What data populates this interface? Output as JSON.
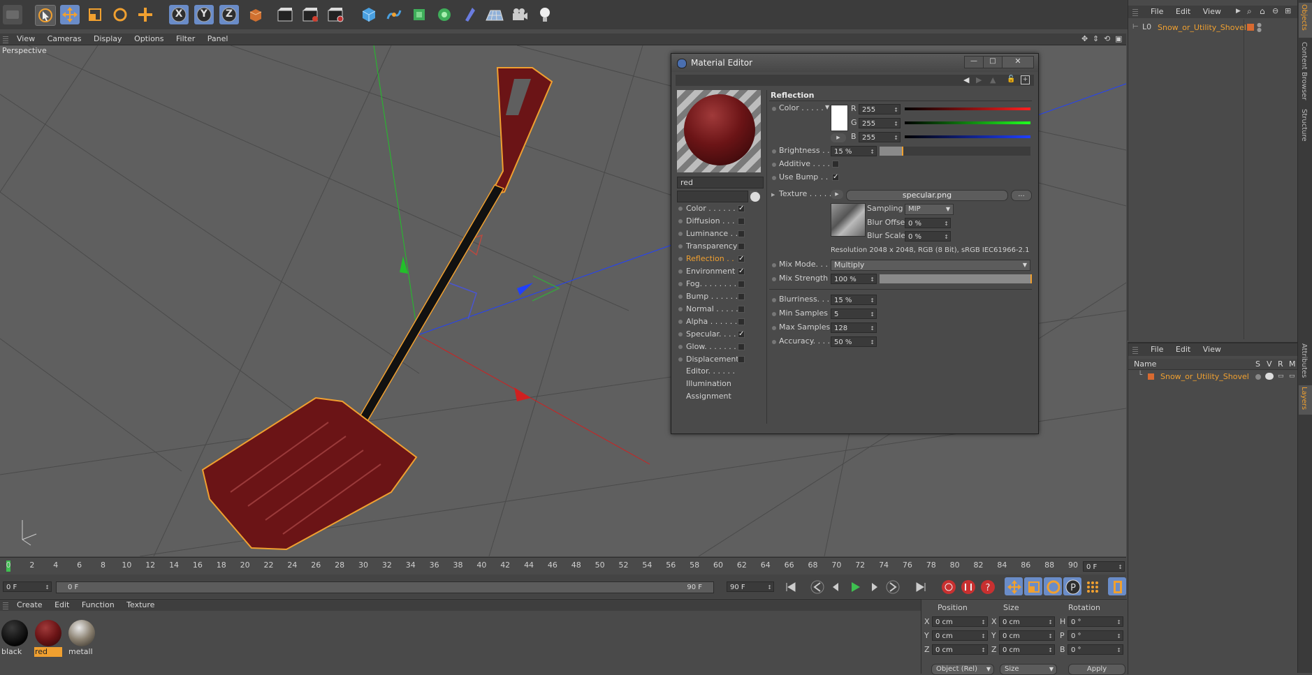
{
  "colors": {
    "accent": "#f0a030",
    "viewport": "#5e5e5e",
    "red": "#6b1416"
  },
  "toolbar": {
    "items": [
      "undo-icon",
      "select-icon",
      "move-icon",
      "scale-icon",
      "rotate-icon",
      "add-icon",
      "x-axis-icon",
      "y-axis-icon",
      "z-axis-icon",
      "coord-system-icon",
      "render-view-icon",
      "render-picture-icon",
      "render-settings-icon",
      "cube-icon",
      "spline-icon",
      "nurbs-icon",
      "mograph-icon",
      "deformer-icon",
      "floor-icon",
      "camera-icon",
      "light-icon"
    ],
    "x_label": "X",
    "y_label": "Y",
    "z_label": "Z"
  },
  "viewport": {
    "menu": [
      "View",
      "Cameras",
      "Display",
      "Options",
      "Filter",
      "Panel"
    ],
    "label": "Perspective"
  },
  "material_editor": {
    "title": "Material Editor",
    "material_name": "red",
    "channels": [
      {
        "label": "Color . . . . . .",
        "checked": true
      },
      {
        "label": "Diffusion . . .",
        "checked": false
      },
      {
        "label": "Luminance . .",
        "checked": false
      },
      {
        "label": "Transparency",
        "checked": false
      },
      {
        "label": "Reflection . .",
        "checked": true,
        "active": true
      },
      {
        "label": "Environment",
        "checked": true
      },
      {
        "label": "Fog. . . . . . . .",
        "checked": false
      },
      {
        "label": "Bump . . . . . .",
        "checked": false
      },
      {
        "label": "Normal . . . . .",
        "checked": false
      },
      {
        "label": "Alpha . . . . . .",
        "checked": false
      },
      {
        "label": "Specular. . . .",
        "checked": true
      },
      {
        "label": "Glow. . . . . . .",
        "checked": false
      },
      {
        "label": "Displacement",
        "checked": false
      }
    ],
    "extras": [
      "Editor. . . . . .",
      "Illumination",
      "Assignment"
    ],
    "section": "Reflection",
    "color_label": "Color . . . . .",
    "r_label": "R",
    "g_label": "G",
    "b_label": "B",
    "r": "255",
    "g": "255",
    "b": "255",
    "brightness_label": "Brightness . . .",
    "brightness": "15 %",
    "brightness_level": 0.15,
    "additive_label": "Additive . . . .",
    "additive": false,
    "use_bump_label": "Use Bump . .",
    "use_bump": true,
    "texture_label": "Texture . . . . .",
    "texture_file": "specular.png",
    "texture_more": "...",
    "sampling_label": "Sampling",
    "sampling": "MIP",
    "blur_offset_label": "Blur Offset",
    "blur_offset": "0 %",
    "blur_scale_label": "Blur Scale",
    "blur_scale": "0 %",
    "resolution": "Resolution 2048 x 2048, RGB (8 Bit), sRGB IEC61966-2.1",
    "mix_mode_label": "Mix Mode. . . .",
    "mix_mode": "Multiply",
    "mix_strength_label": "Mix Strength",
    "mix_strength": "100 %",
    "mix_strength_level": 1.0,
    "blurriness_label": "Blurriness. . . .",
    "blurriness": "15 %",
    "min_samples_label": "Min Samples",
    "min_samples": "5",
    "max_samples_label": "Max Samples",
    "max_samples": "128",
    "accuracy_label": "Accuracy. . . . .",
    "accuracy": "50 %"
  },
  "timeline": {
    "ticks": [
      "0",
      "2",
      "4",
      "6",
      "8",
      "10",
      "12",
      "14",
      "16",
      "18",
      "20",
      "22",
      "24",
      "26",
      "28",
      "30",
      "32",
      "34",
      "36",
      "38",
      "40",
      "42",
      "44",
      "46",
      "48",
      "50",
      "52",
      "54",
      "56",
      "58",
      "60",
      "62",
      "64",
      "66",
      "68",
      "70",
      "72",
      "74",
      "76",
      "78",
      "80",
      "82",
      "84",
      "86",
      "88",
      "90"
    ],
    "current_frame": "0 F",
    "start_frame": "0 F",
    "range_start": "0 F",
    "range_end": "90 F",
    "end_frame": "90 F"
  },
  "material_manager": {
    "menu": [
      "Create",
      "Edit",
      "Function",
      "Texture"
    ],
    "materials": [
      {
        "name": "black",
        "color": "#0b0b0b"
      },
      {
        "name": "red",
        "color": "#6b1416",
        "selected": true
      },
      {
        "name": "metall",
        "color": "#8a8070"
      }
    ]
  },
  "coordinates": {
    "headers": [
      "Position",
      "Size",
      "Rotation"
    ],
    "rows": [
      {
        "axis": "X",
        "pos": "0 cm",
        "size_axis": "X",
        "size": "0 cm",
        "rot_axis": "H",
        "rot": "0 °"
      },
      {
        "axis": "Y",
        "pos": "0 cm",
        "size_axis": "Y",
        "size": "0 cm",
        "rot_axis": "P",
        "rot": "0 °"
      },
      {
        "axis": "Z",
        "pos": "0 cm",
        "size_axis": "Z",
        "size": "0 cm",
        "rot_axis": "B",
        "rot": "0 °"
      }
    ],
    "mode": "Object (Rel)",
    "size_mode": "Size",
    "apply": "Apply"
  },
  "object_manager": {
    "menu": [
      "File",
      "Edit",
      "View"
    ],
    "object_name": "Snow_or_Utility_Shovel"
  },
  "attribute_manager": {
    "menu": [
      "File",
      "Edit",
      "View"
    ],
    "columns": [
      "Name",
      "S",
      "V",
      "R",
      "M"
    ],
    "object_name": "Snow_or_Utility_Shovel"
  },
  "side_tabs": [
    "Objects",
    "Content Browser",
    "Structure"
  ],
  "side_tabs_lower": [
    "Attributes",
    "Layers"
  ]
}
